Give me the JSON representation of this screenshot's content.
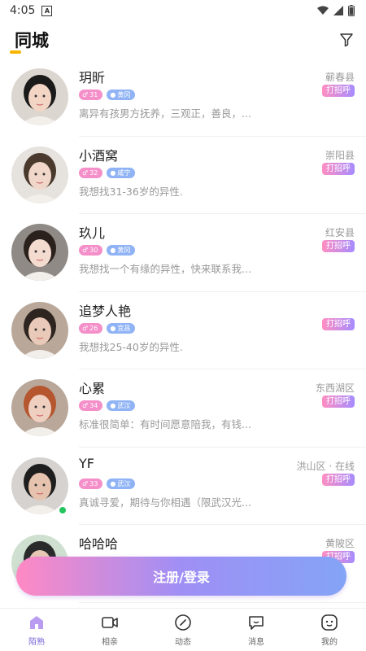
{
  "status": {
    "time": "4:05"
  },
  "header": {
    "title": "同城"
  },
  "users": [
    {
      "name": "玥昕",
      "age": "31",
      "city": "黄冈",
      "desc": "离异有孩男方抚养，三观正，善良，...",
      "location": "蕲春县",
      "greet": "打招呼",
      "online": false,
      "hair": "#1a1a1a",
      "skin": "#f3d5c6",
      "bg": "#dcd6d0"
    },
    {
      "name": "小酒窝",
      "age": "32",
      "city": "咸宁",
      "desc": "我想找31-36岁的异性.",
      "location": "崇阳县",
      "greet": "打招呼",
      "online": false,
      "hair": "#4a3a2e",
      "skin": "#f1d7c9",
      "bg": "#e6e2de"
    },
    {
      "name": "玖儿",
      "age": "30",
      "city": "黄冈",
      "desc": "我想找一个有缘的异性，快来联系我...",
      "location": "红安县",
      "greet": "打招呼",
      "online": false,
      "hair": "#2b211c",
      "skin": "#f4dbcf",
      "bg": "#8f8a86"
    },
    {
      "name": "追梦人艳",
      "age": "26",
      "city": "宜昌",
      "desc": "我想找25-40岁的异性.",
      "location": "",
      "greet": "打招呼",
      "online": false,
      "hair": "#2e2520",
      "skin": "#e9c9b8",
      "bg": "#b9a89a"
    },
    {
      "name": "心累",
      "age": "34",
      "city": "武汉",
      "desc": "标准很简单：有时间愿意陪我，有钱...",
      "location": "东西湖区",
      "greet": "打招呼",
      "online": false,
      "hair": "#b5562f",
      "skin": "#efcfc0",
      "bg": "#b9a79a"
    },
    {
      "name": "YF",
      "age": "33",
      "city": "武汉",
      "desc": "真诚寻爱，期待与你相遇（限武汉光...",
      "location": "洪山区 · 在线",
      "greet": "打招呼",
      "online": true,
      "hair": "#1e1e1e",
      "skin": "#e6c3ae",
      "bg": "#d6d2cf"
    },
    {
      "name": "哈哈哈",
      "age": "",
      "city": "",
      "desc": "",
      "location": "黄陂区",
      "greet": "打招呼",
      "online": false,
      "hair": "#2a2a2a",
      "skin": "#e8c9b5",
      "bg": "#cfe0d0"
    }
  ],
  "cta": {
    "label": "注册/登录"
  },
  "tabs": [
    {
      "label": "陌熟",
      "icon": "home-icon",
      "active": true
    },
    {
      "label": "相亲",
      "icon": "video-icon",
      "active": false
    },
    {
      "label": "动态",
      "icon": "compass-icon",
      "active": false
    },
    {
      "label": "消息",
      "icon": "chat-icon",
      "active": false
    },
    {
      "label": "我的",
      "icon": "profile-icon",
      "active": false
    }
  ],
  "colors": {
    "accent": "#7a68d9",
    "indicator": "#f7b500",
    "greet_from": "#ff8ec2",
    "greet_to": "#a68cff"
  }
}
